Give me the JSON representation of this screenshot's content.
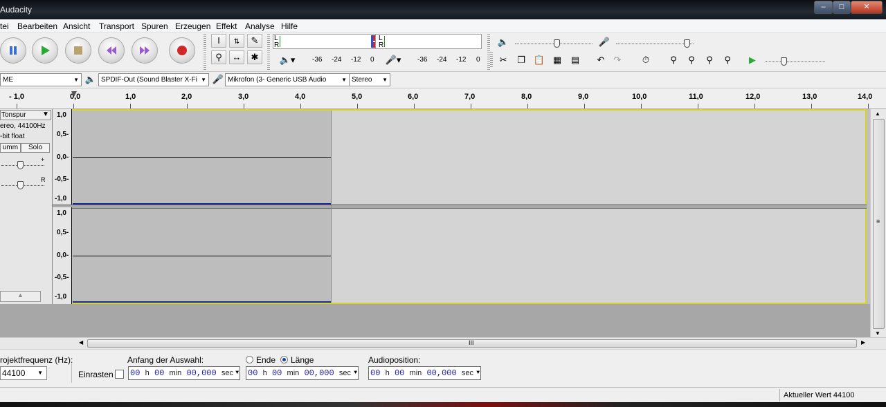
{
  "window": {
    "title": "Audacity"
  },
  "menu": [
    "tei",
    "Bearbeiten",
    "Ansicht",
    "Transport",
    "Spuren",
    "Erzeugen",
    "Effekt",
    "Analyse",
    "Hilfe"
  ],
  "meters": {
    "play_ticks": [
      "-36",
      "-24",
      "-12",
      "0"
    ],
    "rec_ticks": [
      "-36",
      "-24",
      "-12",
      "0"
    ],
    "ch_left": "L",
    "ch_right": "R"
  },
  "devices": {
    "host": "ME",
    "output": "SPDIF-Out (Sound Blaster X-Fi",
    "input": "Mikrofon (3- Generic USB Audio",
    "channels": "Stereo"
  },
  "ruler": {
    "ticks": [
      "- 1,0",
      "0,0",
      "1,0",
      "2,0",
      "3,0",
      "4,0",
      "5,0",
      "6,0",
      "7,0",
      "8,0",
      "9,0",
      "10,0",
      "11,0",
      "12,0",
      "13,0",
      "14,0"
    ]
  },
  "track": {
    "name": "Tonspur",
    "info1": "ereo, 44100Hz",
    "info2": "-bit float",
    "mute": "umm",
    "solo": "Solo",
    "gain_plus": "+",
    "pan_r": "R",
    "scale": [
      "1,0",
      "0,5-",
      "0,0-",
      "-0,5-",
      "-1,0"
    ]
  },
  "hscroll_grip": "III",
  "selection": {
    "rate_label": "rojektfrequenz (Hz):",
    "rate_value": "44100",
    "snap_label": "Einrasten",
    "start_label": "Anfang der Auswahl:",
    "end_option": "Ende",
    "length_option": "Länge",
    "audiopos_label": "Audioposition:",
    "tc_h": "00",
    "tc_hu": "h",
    "tc_m": "00",
    "tc_mu": "min",
    "tc_s": "00,000",
    "tc_su": "sec"
  },
  "status": {
    "right": "Aktueller Wert 44100"
  }
}
